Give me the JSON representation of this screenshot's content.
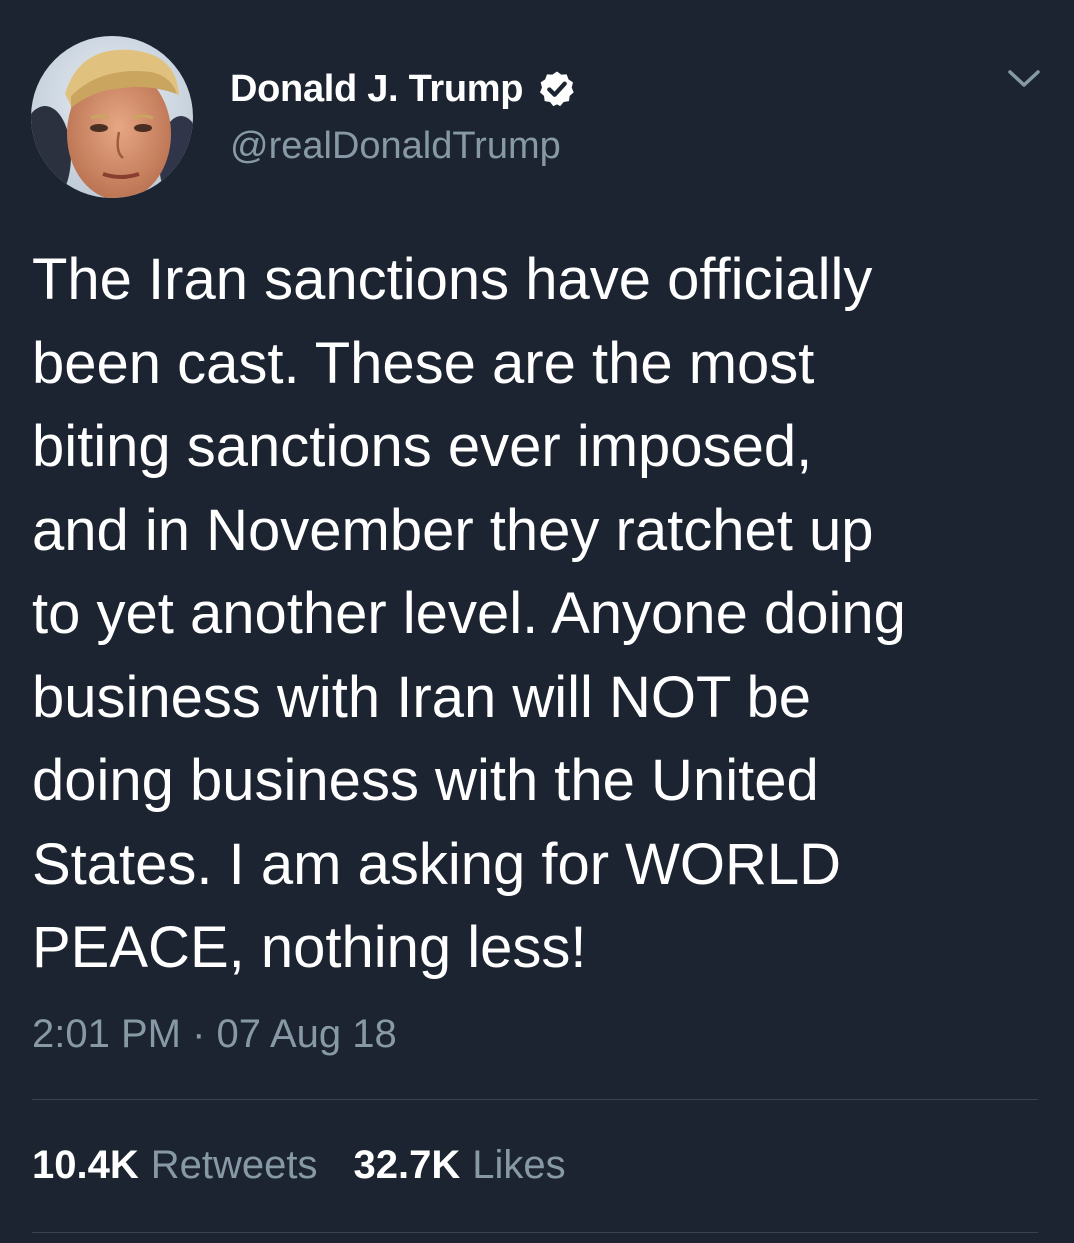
{
  "tweet": {
    "author": {
      "display_name": "Donald J. Trump",
      "handle": "@realDonaldTrump",
      "verified": true,
      "avatar_icon": "profile-photo"
    },
    "text_lines": [
      "The Iran sanctions have officially",
      "been cast. These are the most",
      "biting sanctions ever imposed,",
      "and in November they ratchet up",
      "to yet another level. Anyone doing",
      "business with Iran will NOT be",
      "doing business with the United",
      "States. I am asking for WORLD",
      "PEACE, nothing less!"
    ],
    "time": "2:01 PM",
    "separator": "·",
    "date": "07 Aug 18",
    "stats": {
      "retweets_count": "10.4K",
      "retweets_label": "Retweets",
      "likes_count": "32.7K",
      "likes_label": "Likes"
    }
  },
  "icons": {
    "verified": "verified-badge-icon",
    "menu": "chevron-down-icon"
  },
  "colors": {
    "background": "#1b2430",
    "primary_text": "#ffffff",
    "secondary_text": "#8899a6",
    "divider": "#38444d"
  }
}
